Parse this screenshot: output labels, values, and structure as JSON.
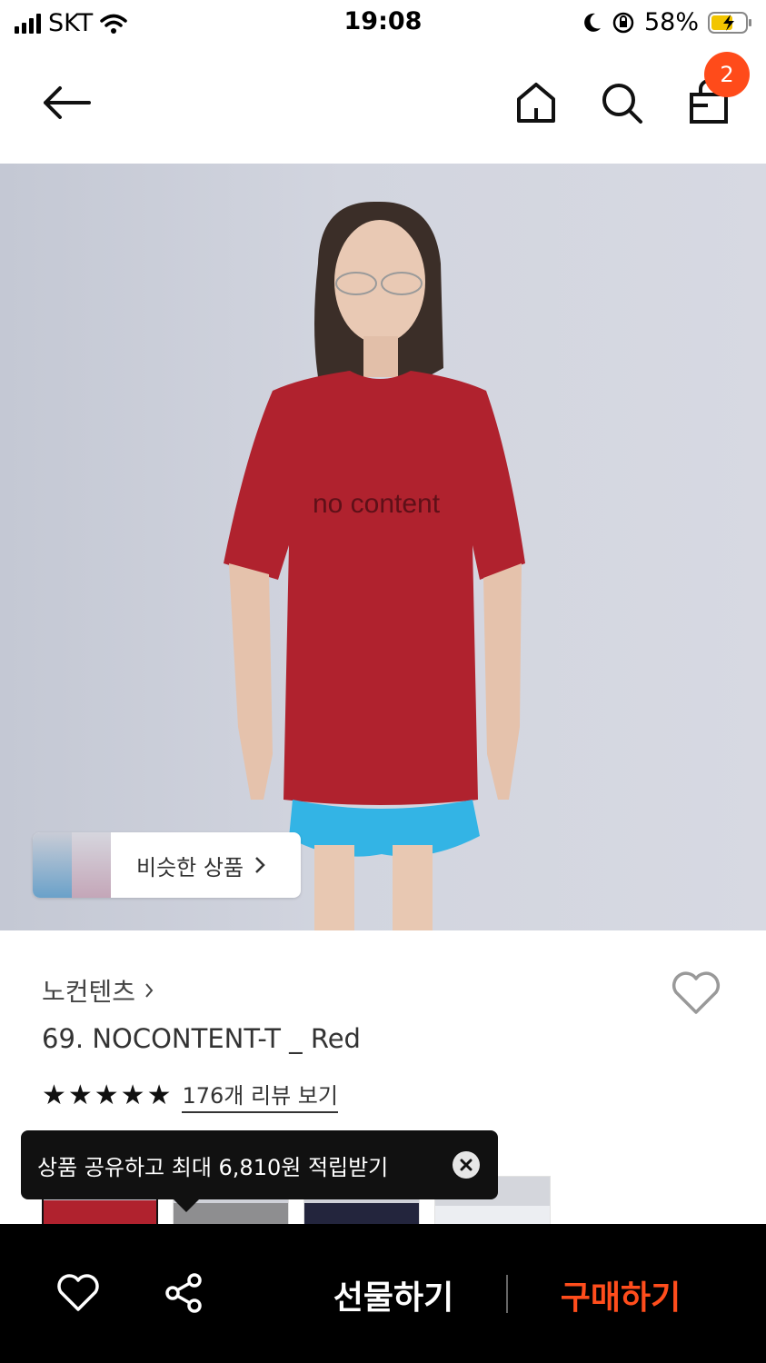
{
  "status_bar": {
    "carrier": "SKT",
    "time": "19:08",
    "battery": "58%"
  },
  "header": {
    "cart_count": "2"
  },
  "hero": {
    "similar_label": "비슷한 상품"
  },
  "product": {
    "brand": "노컨텐츠",
    "name": "69. NOCONTENT-T _ Red",
    "rating_stars": 5,
    "review_link": "176개 리뷰 보기"
  },
  "tooltip": {
    "text": "상품 공유하고 최대 6,810원 적립받기"
  },
  "bottom_bar": {
    "gift_label": "선물하기",
    "buy_label": "구매하기"
  },
  "colors": {
    "accent": "#ff4b1a",
    "shirt": "#b0222e",
    "bottom_bar": "#000000"
  },
  "icons": [
    "back-arrow-icon",
    "home-icon",
    "search-icon",
    "shopping-bag-icon",
    "heart-icon",
    "share-icon",
    "close-icon",
    "chevron-right-icon",
    "star-icon",
    "wifi-icon",
    "signal-icon",
    "moon-icon",
    "rotation-lock-icon",
    "battery-icon"
  ]
}
